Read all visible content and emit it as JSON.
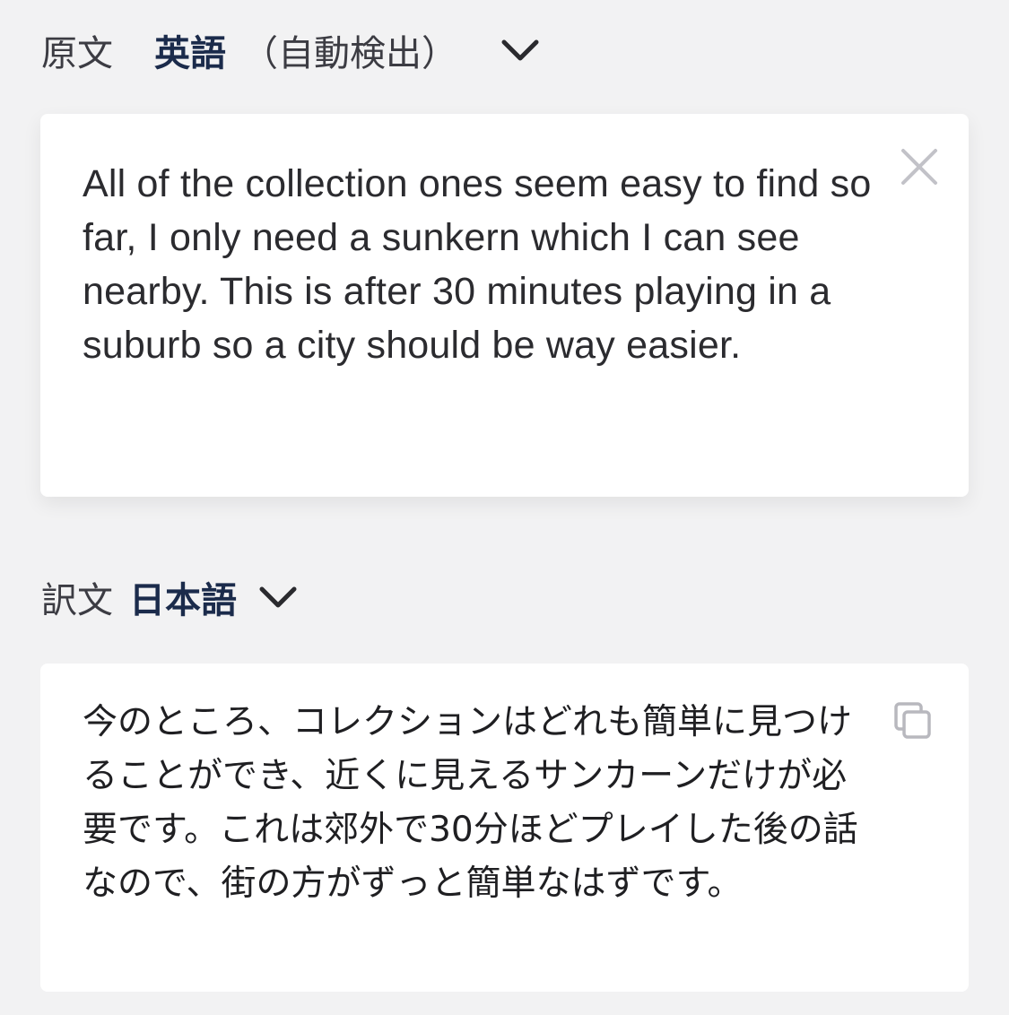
{
  "source": {
    "label": "原文",
    "language": "英語",
    "detect_note": "（自動検出）",
    "text": "All of the collection ones seem easy to find so far, I only need a sunkern which I can see nearby. This is after 30 minutes playing in a suburb so a city should be way easier.",
    "clear_icon": "close-icon"
  },
  "target": {
    "label": "訳文",
    "language": "日本語",
    "text": "今のところ、コレクションはどれも簡単に見つけることができ、近くに見えるサンカーンだけが必要です。これは郊外で30分ほどプレイした後の話なので、街の方がずっと簡単なはずです。",
    "copy_icon": "copy-icon"
  },
  "colors": {
    "background": "#f2f2f3",
    "card": "#ffffff",
    "language_accent": "#1b2b4b",
    "label_text": "#3c3c43",
    "icon_gray": "#b8b8be"
  }
}
